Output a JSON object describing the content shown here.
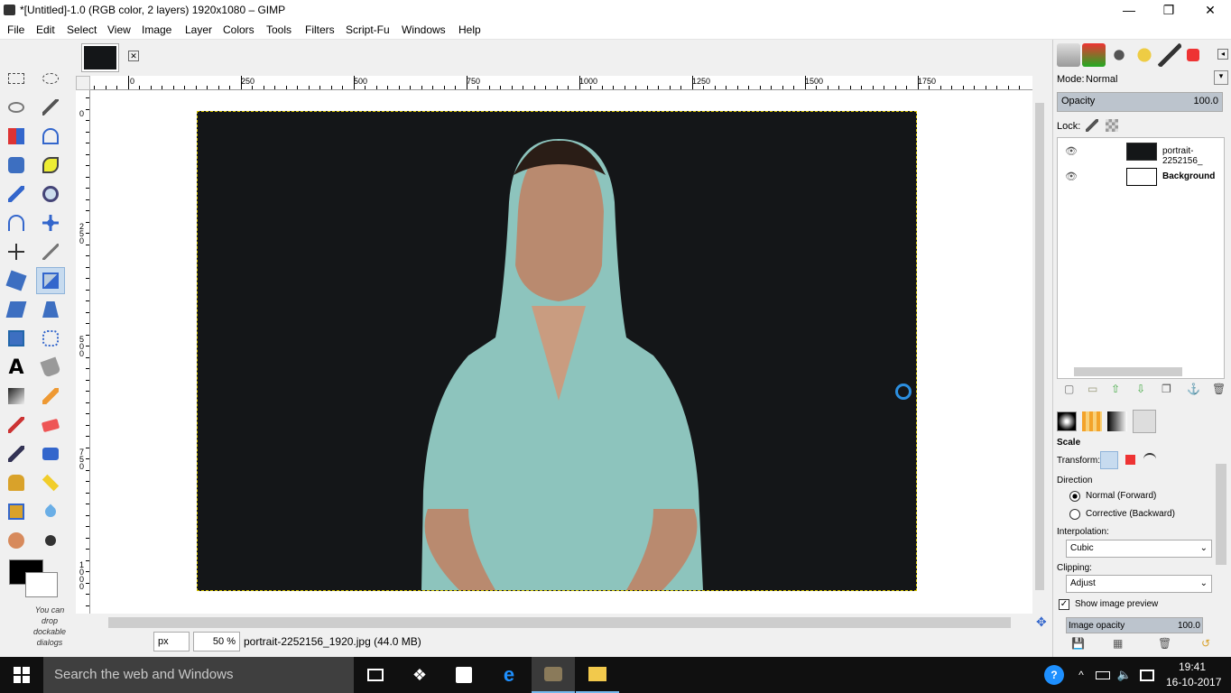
{
  "window": {
    "title": "*[Untitled]-1.0 (RGB color, 2 layers) 1920x1080 – GIMP",
    "minimize": "—",
    "maximize": "❐",
    "close": "✕"
  },
  "menu": [
    "File",
    "Edit",
    "Select",
    "View",
    "Image",
    "Layer",
    "Colors",
    "Tools",
    "Filters",
    "Script-Fu",
    "Windows",
    "Help"
  ],
  "toolbox": {
    "selected_tool": "scale",
    "drop_note": "You can drop dockable dialogs"
  },
  "image_tab": {
    "close": "✕"
  },
  "ruler_h_labels": [
    "0",
    "250",
    "500",
    "750",
    "1000",
    "1250",
    "1500",
    "1750"
  ],
  "ruler_v_labels": [
    "0",
    "250",
    "500",
    "750",
    "1000"
  ],
  "status": {
    "unit": "px",
    "zoom": "50 %",
    "info": "portrait-2252156_1920.jpg (44.0 MB)"
  },
  "layers_panel": {
    "mode_label": "Mode:",
    "mode_value": "Normal",
    "opacity_label": "Opacity",
    "opacity_value": "100.0",
    "lock_label": "Lock:",
    "layers": [
      {
        "name": "portrait-2252156_",
        "visible": true
      },
      {
        "name": "Background",
        "visible": true
      }
    ]
  },
  "tool_options": {
    "tool_name": "Scale",
    "transform_label": "Transform:",
    "direction_label": "Direction",
    "direction_options": [
      "Normal (Forward)",
      "Corrective (Backward)"
    ],
    "direction_selected": "Normal (Forward)",
    "interpolation_label": "Interpolation:",
    "interpolation_value": "Cubic",
    "clipping_label": "Clipping:",
    "clipping_value": "Adjust",
    "show_preview_label": "Show image preview",
    "show_preview_checked": true,
    "image_opacity_label": "Image opacity",
    "image_opacity_value": "100.0"
  },
  "taskbar": {
    "search_placeholder": "Search the web and Windows",
    "time": "19:41",
    "date": "16-10-2017"
  },
  "colors": {
    "canvas_bg": "#141618",
    "hoodie": "#8dc4bd",
    "selection": "#c7dbef",
    "taskbar": "#101010"
  }
}
